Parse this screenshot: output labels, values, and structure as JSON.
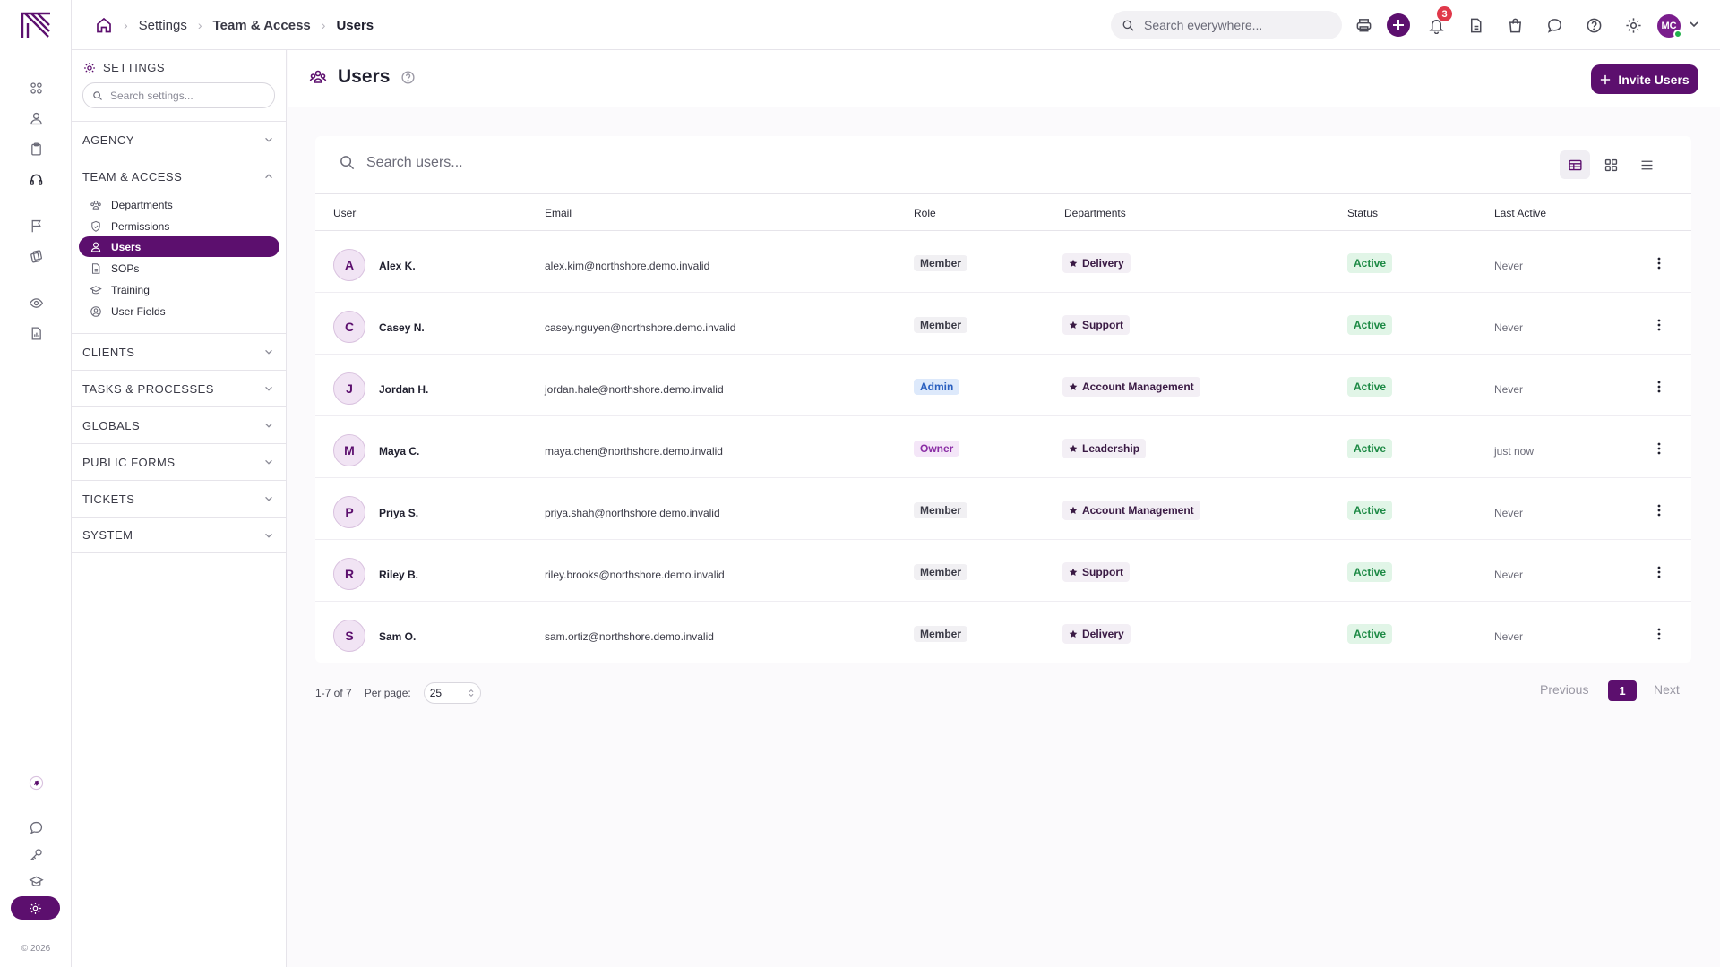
{
  "rail": {
    "copyright": "© 2026"
  },
  "topbar": {
    "breadcrumb": [
      "Settings",
      "Team & Access",
      "Users"
    ],
    "search_placeholder": "Search everywhere...",
    "notification_count": "3",
    "user_initials": "MC"
  },
  "sidebar": {
    "header": "SETTINGS",
    "search_placeholder": "Search settings...",
    "sections": {
      "agency": "AGENCY",
      "team": "TEAM & ACCESS",
      "clients": "CLIENTS",
      "tasks": "TASKS & PROCESSES",
      "globals": "GLOBALS",
      "forms": "PUBLIC FORMS",
      "tickets": "TICKETS",
      "system": "SYSTEM"
    },
    "team_items": [
      {
        "label": "Departments",
        "icon": "departments-icon"
      },
      {
        "label": "Permissions",
        "icon": "shield-icon"
      },
      {
        "label": "Users",
        "icon": "user-icon",
        "active": true
      },
      {
        "label": "SOPs",
        "icon": "document-icon"
      },
      {
        "label": "Training",
        "icon": "graduation-cap-icon"
      },
      {
        "label": "User Fields",
        "icon": "user-circle-icon"
      }
    ]
  },
  "page": {
    "title": "Users",
    "invite_label": "Invite Users"
  },
  "table": {
    "search_placeholder": "Search users...",
    "headers": {
      "user": "User",
      "email": "Email",
      "role": "Role",
      "departments": "Departments",
      "status": "Status",
      "last_active": "Last Active"
    },
    "rows": [
      {
        "initial": "A",
        "name": "Alex K.",
        "email": "alex.kim@northshore.demo.invalid",
        "role": "Member",
        "department": "Delivery",
        "status": "Active",
        "last_active": "Never"
      },
      {
        "initial": "C",
        "name": "Casey N.",
        "email": "casey.nguyen@northshore.demo.invalid",
        "role": "Member",
        "department": "Support",
        "status": "Active",
        "last_active": "Never"
      },
      {
        "initial": "J",
        "name": "Jordan H.",
        "email": "jordan.hale@northshore.demo.invalid",
        "role": "Admin",
        "department": "Account Management",
        "status": "Active",
        "last_active": "Never"
      },
      {
        "initial": "M",
        "name": "Maya C.",
        "email": "maya.chen@northshore.demo.invalid",
        "role": "Owner",
        "department": "Leadership",
        "status": "Active",
        "last_active": "just now"
      },
      {
        "initial": "P",
        "name": "Priya S.",
        "email": "priya.shah@northshore.demo.invalid",
        "role": "Member",
        "department": "Account Management",
        "status": "Active",
        "last_active": "Never"
      },
      {
        "initial": "R",
        "name": "Riley B.",
        "email": "riley.brooks@northshore.demo.invalid",
        "role": "Member",
        "department": "Support",
        "status": "Active",
        "last_active": "Never"
      },
      {
        "initial": "S",
        "name": "Sam O.",
        "email": "sam.ortiz@northshore.demo.invalid",
        "role": "Member",
        "department": "Delivery",
        "status": "Active",
        "last_active": "Never"
      }
    ]
  },
  "pagination": {
    "range": "1-7 of 7",
    "per_page_label": "Per page:",
    "per_page_value": "25",
    "prev_label": "Previous",
    "current_page": "1",
    "next_label": "Next"
  },
  "colors": {
    "brand": "#5c0f6e",
    "status_active_bg": "#e1f5e7",
    "status_active_text": "#1d8a45",
    "notification": "#e0384a"
  }
}
